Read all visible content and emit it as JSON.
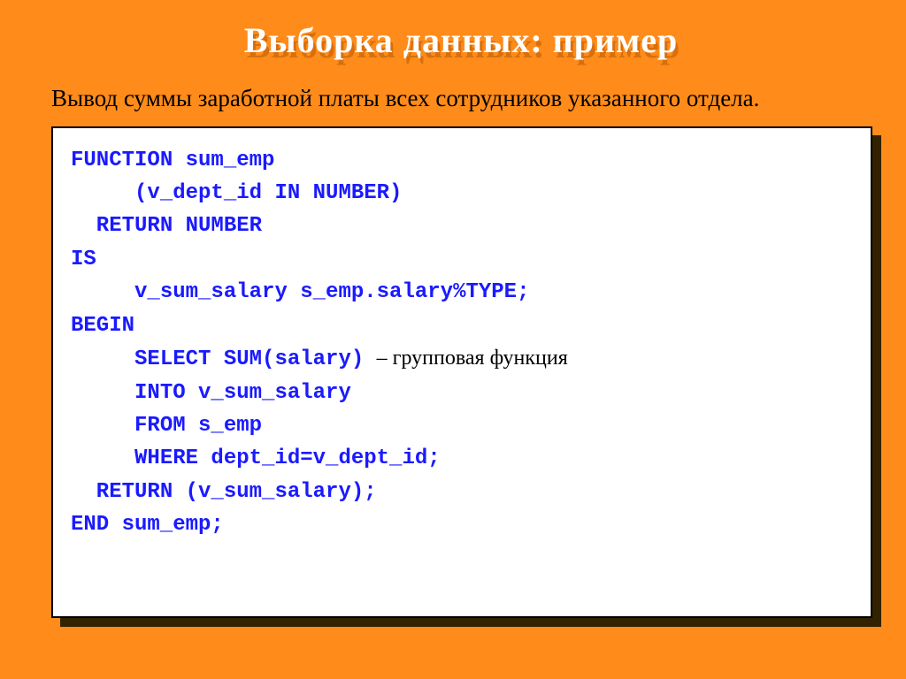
{
  "title": "Выборка данных: пример",
  "subtitle": "Вывод суммы заработной платы всех сотрудников указанного отдела.",
  "code": {
    "l1": "FUNCTION sum_emp",
    "l2": "     (v_dept_id IN NUMBER)",
    "l3": "  RETURN NUMBER",
    "l4": "IS",
    "l5": "     v_sum_salary s_emp.salary%TYPE;",
    "l6": "BEGIN",
    "l7a": "     SELECT SUM(salary) ",
    "l7b": "– групповая функция",
    "l8": "     INTO v_sum_salary",
    "l9": "     FROM s_emp",
    "l10": "     WHERE dept_id=v_dept_id;",
    "l11": "  RETURN (v_sum_salary);",
    "l12": "END sum_emp;"
  }
}
